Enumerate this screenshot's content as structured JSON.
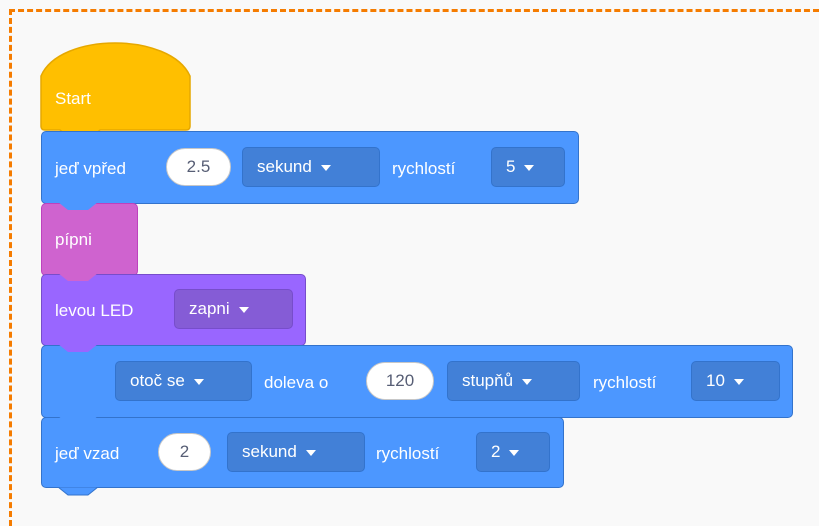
{
  "colors": {
    "frame": "#f57c00",
    "motion": "#4c97ff",
    "motion_field": "#4280d7",
    "sound": "#cf63cf",
    "looks": "#9966ff",
    "looks_field": "#855cd6",
    "hat": "#ffbf00"
  },
  "blocks": {
    "start": {
      "label": "Start"
    },
    "forward": {
      "label": "jeď vpřed",
      "value": "2.5",
      "unit": "sekund",
      "speed_label": "rychlostí",
      "speed": "5"
    },
    "beep": {
      "label": "pípni"
    },
    "led": {
      "label": "levou LED",
      "state": "zapni"
    },
    "turn": {
      "action": "otoč se",
      "direction_label": "doleva o",
      "value": "120",
      "unit": "stupňů",
      "speed_label": "rychlostí",
      "speed": "10"
    },
    "backward": {
      "label": "jeď vzad",
      "value": "2",
      "unit": "sekund",
      "speed_label": "rychlostí",
      "speed": "2"
    }
  }
}
